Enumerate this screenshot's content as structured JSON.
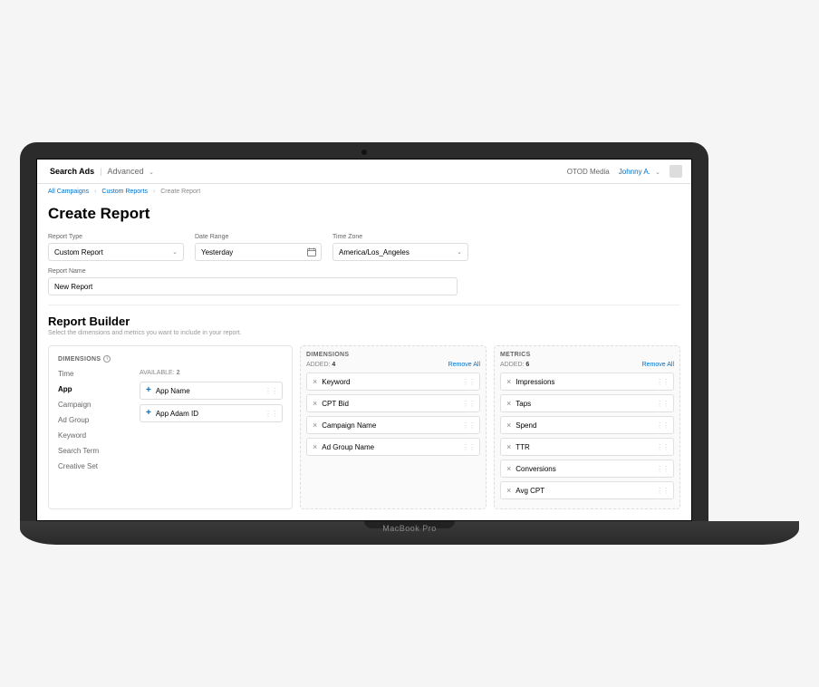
{
  "header": {
    "brand": "Search Ads",
    "tier": "Advanced",
    "org": "OTOD Media",
    "user": "Johnny A."
  },
  "breadcrumbs": {
    "items": [
      "All Campaigns",
      "Custom Reports",
      "Create Report"
    ]
  },
  "page": {
    "title": "Create Report"
  },
  "form": {
    "report_type": {
      "label": "Report Type",
      "value": "Custom Report"
    },
    "date_range": {
      "label": "Date Range",
      "value": "Yesterday"
    },
    "time_zone": {
      "label": "Time Zone",
      "value": "America/Los_Angeles"
    },
    "report_name": {
      "label": "Report Name",
      "value": "New Report"
    }
  },
  "builder": {
    "title": "Report Builder",
    "subtitle": "Select the dimensions and metrics you want to include in your report.",
    "dimensions_header": "DIMENSIONS",
    "metrics_header": "METRICS",
    "tabs": [
      "Time",
      "App",
      "Campaign",
      "Ad Group",
      "Keyword",
      "Search Term",
      "Creative Set"
    ],
    "active_tab": "App",
    "available_label": "AVAILABLE:",
    "available_count": "2",
    "available_items": [
      "App Name",
      "App Adam ID"
    ],
    "added_label": "ADDED:",
    "remove_all": "Remove All",
    "dimensions_added_count": "4",
    "dimensions_added": [
      "Keyword",
      "CPT Bid",
      "Campaign Name",
      "Ad Group Name"
    ],
    "metrics_added_count": "6",
    "metrics_added": [
      "Impressions",
      "Taps",
      "Spend",
      "TTR",
      "Conversions",
      "Avg CPT"
    ]
  },
  "device": {
    "label": "MacBook Pro"
  }
}
